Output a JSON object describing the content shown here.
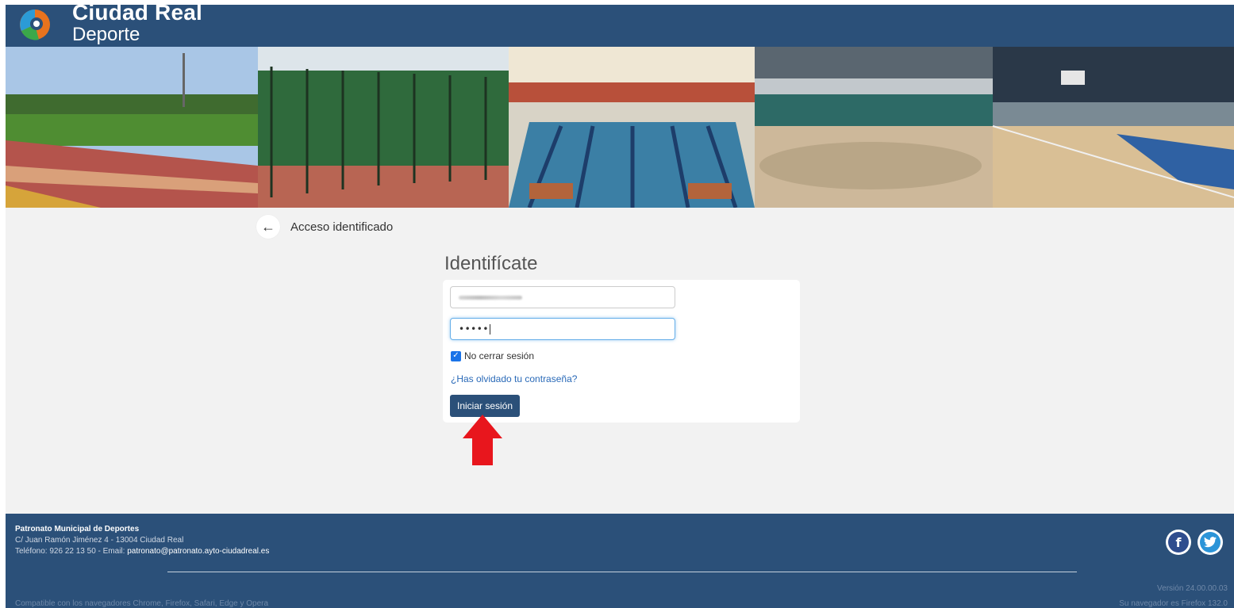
{
  "brand": {
    "name_main": "Ciudad Real",
    "name_sub": "Deporte"
  },
  "page": {
    "back_title": "Acceso identificado",
    "login_title": "Identifícate"
  },
  "login_form": {
    "password_mask": "•••••",
    "remember_label": "No cerrar sesión",
    "remember_checked": true,
    "forgot_link": "¿Has olvidado tu contraseña?",
    "submit_label": "Iniciar sesión"
  },
  "footer": {
    "org_name": "Patronato Municipal de Deportes",
    "address": "C/ Juan Ramón Jiménez 4 - 13004 Ciudad Real",
    "phone_prefix": "Teléfono: 926 22 13 50 - Email: ",
    "email": "patronato@patronato.ayto-ciudadreal.es",
    "compatibility": "Compatible con los navegadores Chrome, Firefox, Safari, Edge y Opera",
    "version": "Versión 24.00.00.03",
    "browser_info": "Su navegador es Firefox 132.0"
  },
  "social": {
    "facebook_glyph": "f",
    "twitter_glyph": "t"
  },
  "colors": {
    "brand_blue": "#2b5079",
    "link_blue": "#2a6ab8",
    "annotation_red": "#e8161d"
  },
  "icons": {
    "back": "arrow-left-icon",
    "annotation": "red-up-arrow-icon"
  }
}
